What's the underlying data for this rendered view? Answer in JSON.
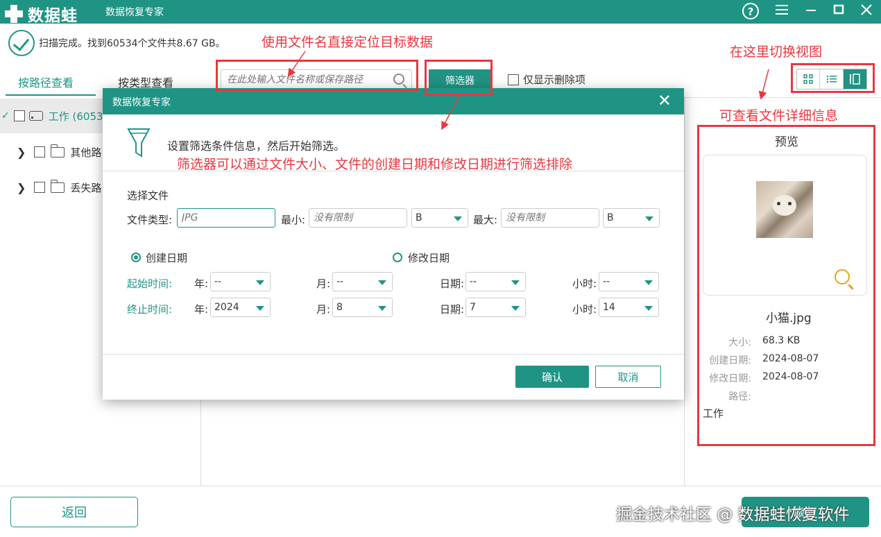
{
  "titlebar": {
    "logo": "数据蛙",
    "title": "数据恢复专家"
  },
  "status": {
    "text": "扫描完成。找到60534个文件共8.67 GB。"
  },
  "tabs": {
    "by_path": "按路径查看",
    "by_type": "按类型查看"
  },
  "tree": {
    "items": [
      {
        "label": "工作 (6053",
        "selected": true
      },
      {
        "label": "其他路"
      },
      {
        "label": "丢失路"
      }
    ]
  },
  "toolbar": {
    "search_placeholder": "在此处输入文件名称或保存路径",
    "filter_label": "筛选器",
    "only_deleted_label": "仅显示删除项"
  },
  "preview": {
    "title": "预览",
    "file_name": "小猫.jpg",
    "size_label": "大小:",
    "size_value": "68.3 KB",
    "created_label": "创建日期:",
    "created_value": "2024-08-07",
    "modified_label": "修改日期:",
    "modified_value": "2024-08-07",
    "path_label": "路径:",
    "path_value": "工作"
  },
  "annotations": {
    "search": "使用文件名直接定位目标数据",
    "view_switch": "在这里切换视图",
    "details": "可查看文件详细信息",
    "filter": "筛选器可以通过文件大小、文件的创建日期和修改日期进行筛选排除"
  },
  "modal": {
    "title": "数据恢复专家",
    "intro": "设置筛选条件信息，然后开始筛选。",
    "section_select_file": "选择文件",
    "file_type_label": "文件类型:",
    "file_type_placeholder": "JPG",
    "min_label": "最小:",
    "min_placeholder": "没有限制",
    "min_unit": "B",
    "max_label": "最大:",
    "max_placeholder": "没有限制",
    "max_unit": "B",
    "radio_created": "创建日期",
    "radio_modified": "修改日期",
    "start_label": "起始时间:",
    "end_label": "终止时间:",
    "year_label": "年:",
    "month_label": "月:",
    "day_label": "日期:",
    "hour_label": "小时:",
    "start": {
      "year": "--",
      "month": "--",
      "day": "--",
      "hour": "--"
    },
    "end": {
      "year": "2024",
      "month": "8",
      "day": "7",
      "hour": "14"
    },
    "ok_label": "确认",
    "cancel_label": "取消"
  },
  "footer": {
    "back_label": "返回",
    "recover_label": "恢复",
    "watermark": "掘金技术社区 @ 数据蛙恢复软件"
  },
  "colors": {
    "accent": "#1f9484",
    "annotation_red": "#e8373e",
    "zoom_orange": "#e9a21d"
  }
}
